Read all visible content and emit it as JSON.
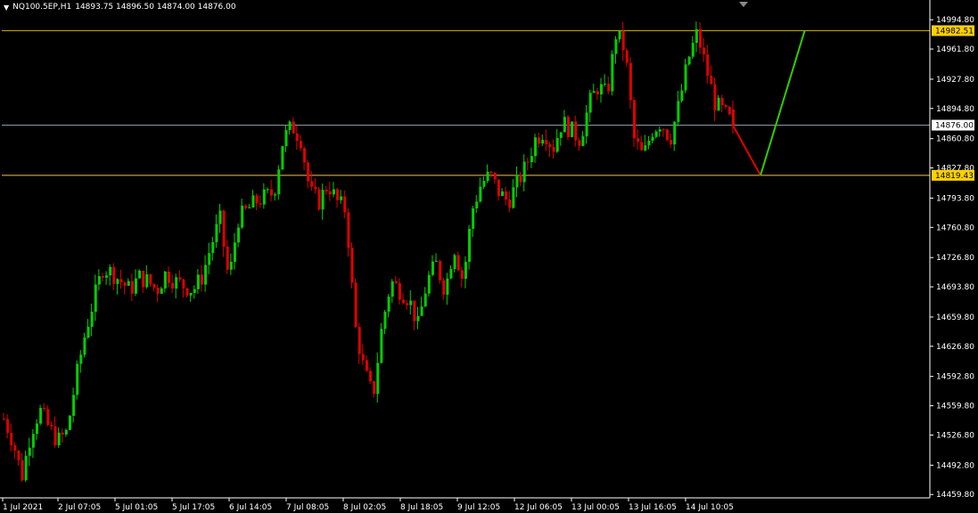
{
  "header": {
    "symbol": "NQ100.5EP,H1",
    "ohlc": "14893.75 14896.50 14874.00 14876.00"
  },
  "colors": {
    "background": "#000000",
    "bull": "#00d000",
    "bear": "#e00000",
    "axis": "#ffffff",
    "resistance_line": "#d4b800",
    "support_line": "#f0c060",
    "current_line": "#8899aa",
    "projection_down": "#e00000",
    "projection_up": "#33cc00"
  },
  "chart_data": {
    "type": "candlestick",
    "price_axis_ticks": [
      "14994.80",
      "14961.80",
      "14927.80",
      "14894.80",
      "14860.80",
      "14827.80",
      "14793.80",
      "14760.80",
      "14726.80",
      "14693.80",
      "14659.80",
      "14626.80",
      "14592.80",
      "14559.80",
      "14526.80",
      "14492.80",
      "14459.80"
    ],
    "time_axis_labels": [
      "1 Jul 2021",
      "2 Jul 07:05",
      "5 Jul 01:05",
      "5 Jul 17:05",
      "6 Jul 14:05",
      "7 Jul 08:05",
      "8 Jul 02:05",
      "8 Jul 18:05",
      "9 Jul 12:05",
      "12 Jul 06:05",
      "13 Jul 00:05",
      "13 Jul 16:05",
      "14 Jul 10:05"
    ],
    "ylim": [
      14456,
      15003
    ],
    "levels": [
      {
        "label": "14982.51",
        "price": 14982.51,
        "role": "resistance"
      },
      {
        "label": "14876.00",
        "price": 14876.0,
        "role": "current"
      },
      {
        "label": "14819.43",
        "price": 14819.43,
        "role": "support"
      }
    ],
    "projection": [
      {
        "bar": 0,
        "price": 14876.0
      },
      {
        "bar": 10,
        "price": 14819.43
      },
      {
        "bar": 26,
        "price": 14982.51
      }
    ],
    "path": [
      14545,
      14520,
      14480,
      14530,
      14555,
      14535,
      14520,
      14530,
      14590,
      14640,
      14680,
      14715,
      14710,
      14700,
      14690,
      14705,
      14700,
      14690,
      14710,
      14700,
      14695,
      14690,
      14705,
      14740,
      14770,
      14700,
      14770,
      14780,
      14790,
      14795,
      14800,
      14860,
      14875,
      14860,
      14800,
      14790,
      14810,
      14790,
      14780,
      14650,
      14600,
      14570,
      14650,
      14700,
      14690,
      14680,
      14650,
      14700,
      14720,
      14690,
      14740,
      14700,
      14780,
      14810,
      14820,
      14800,
      14790,
      14810,
      14830,
      14860,
      14870,
      14850,
      14880,
      14870,
      14860,
      14900,
      14920,
      14910,
      14980,
      14960,
      14860,
      14840,
      14870,
      14880,
      14860,
      14900,
      14950,
      14980,
      14940,
      14900,
      14890,
      14876
    ]
  }
}
